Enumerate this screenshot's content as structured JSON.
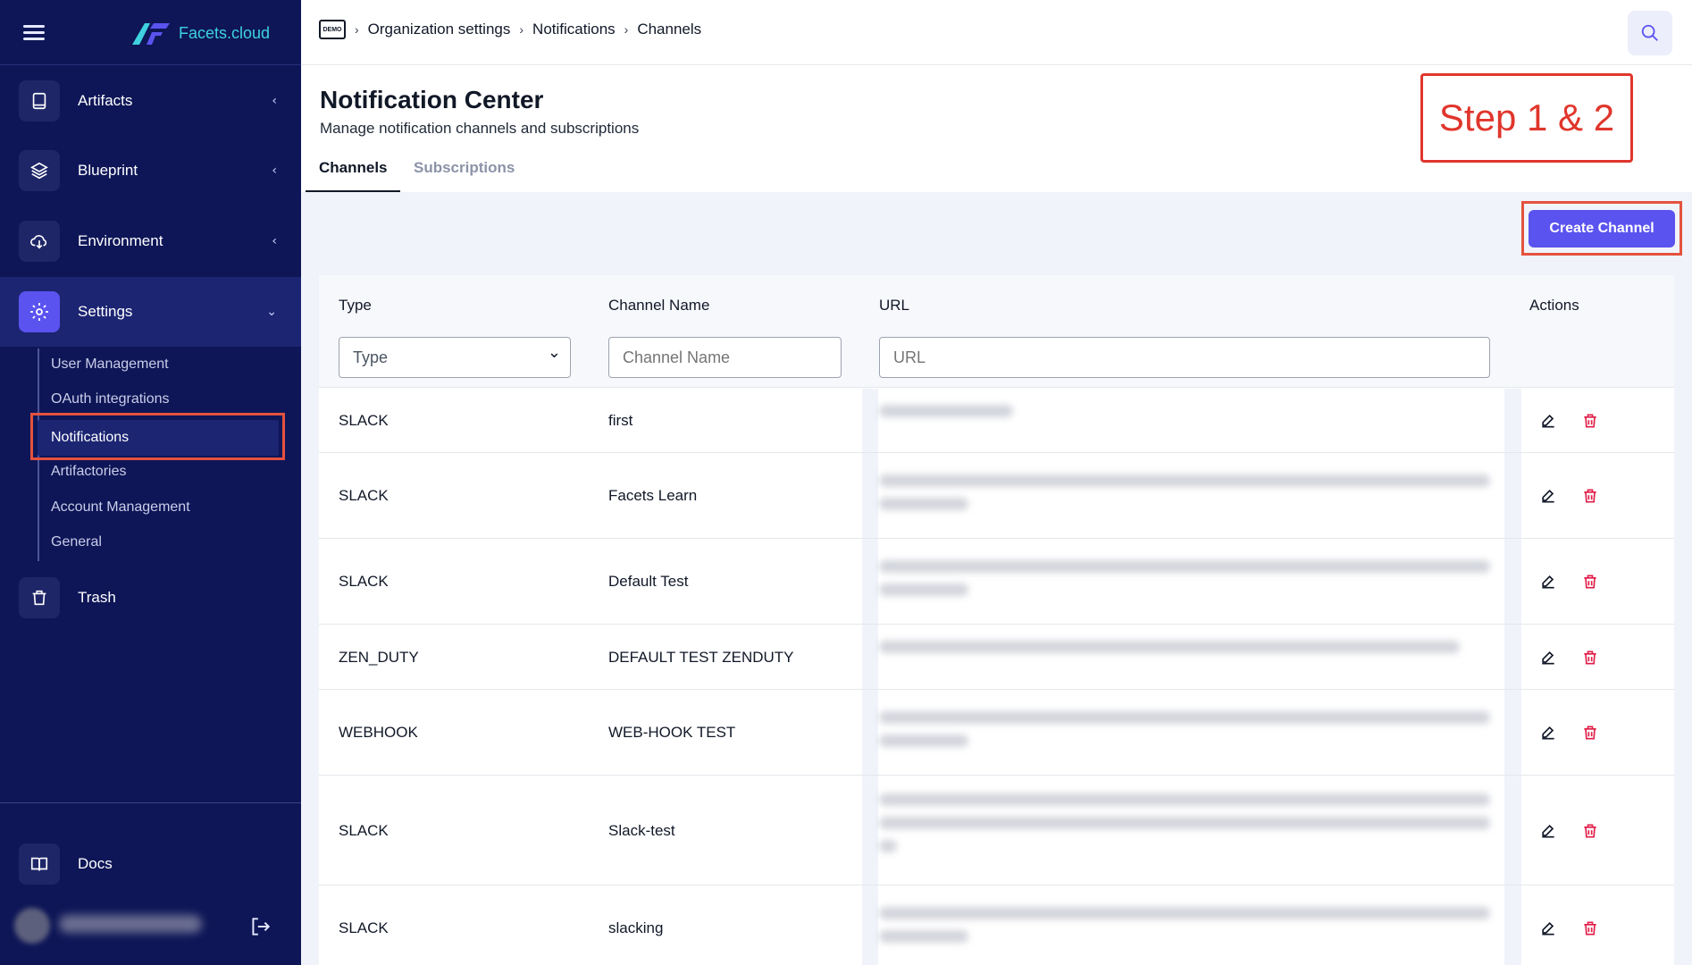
{
  "app": {
    "name": "Facets.cloud"
  },
  "colors": {
    "sidebar_bg": "#0e1657",
    "accent": "#5b53ef",
    "annotation_red": "#e0362c",
    "delete_red": "#e11d48"
  },
  "sidebar": {
    "items": [
      {
        "label": "Artifacts",
        "icon": "book-icon"
      },
      {
        "label": "Blueprint",
        "icon": "layers-icon"
      },
      {
        "label": "Environment",
        "icon": "cloud-download-icon"
      },
      {
        "label": "Settings",
        "icon": "gear-icon"
      },
      {
        "label": "Trash",
        "icon": "trash-icon"
      }
    ],
    "settings_sub": [
      "User Management",
      "OAuth integrations",
      "Notifications",
      "Artifactories",
      "Account Management",
      "General"
    ],
    "docs_label": "Docs"
  },
  "breadcrumb": {
    "icon_text": "DEMO",
    "items": [
      "Organization settings",
      "Notifications",
      "Channels"
    ]
  },
  "header": {
    "title": "Notification Center",
    "subtitle": "Manage notification channels and subscriptions"
  },
  "annotation": {
    "step_label": "Step 1 & 2"
  },
  "tabs": [
    "Channels",
    "Subscriptions"
  ],
  "toolbar": {
    "create_label": "Create Channel"
  },
  "table": {
    "columns": [
      "Type",
      "Channel Name",
      "URL",
      "Actions"
    ],
    "filters": {
      "type_value": "Type",
      "name_placeholder": "Channel Name",
      "url_placeholder": "URL"
    },
    "rows": [
      {
        "type": "SLACK",
        "name": "first"
      },
      {
        "type": "SLACK",
        "name": "Facets Learn"
      },
      {
        "type": "SLACK",
        "name": "Default Test"
      },
      {
        "type": "ZEN_DUTY",
        "name": "DEFAULT TEST ZENDUTY"
      },
      {
        "type": "WEBHOOK",
        "name": "WEB-HOOK TEST"
      },
      {
        "type": "SLACK",
        "name": "Slack-test"
      },
      {
        "type": "SLACK",
        "name": "slacking"
      }
    ]
  }
}
